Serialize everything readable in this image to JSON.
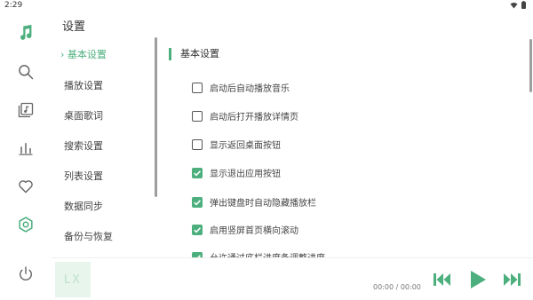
{
  "status_bar": {
    "time": "2:29"
  },
  "colors": {
    "accent": "#4caf7d",
    "accent_light": "#e8f5ec"
  },
  "rail": {
    "items": [
      {
        "name": "app-logo-icon"
      },
      {
        "name": "search-icon"
      },
      {
        "name": "music-library-icon"
      },
      {
        "name": "leaderboard-icon"
      },
      {
        "name": "favorite-heart-icon"
      },
      {
        "name": "settings-icon",
        "active": true
      },
      {
        "name": "power-icon"
      }
    ]
  },
  "page": {
    "title": "设置"
  },
  "settings_nav": {
    "items": [
      {
        "label": "基本设置",
        "active": true,
        "marker": "›"
      },
      {
        "label": "播放设置"
      },
      {
        "label": "桌面歌词"
      },
      {
        "label": "搜索设置"
      },
      {
        "label": "列表设置"
      },
      {
        "label": "数据同步"
      },
      {
        "label": "备份与恢复"
      }
    ]
  },
  "content": {
    "section_title": "基本设置",
    "options": [
      {
        "label": "启动后自动播放音乐",
        "checked": false
      },
      {
        "label": "启动后打开播放详情页",
        "checked": false
      },
      {
        "label": "显示返回桌面按钮",
        "checked": false
      },
      {
        "label": "显示退出应用按钮",
        "checked": true
      },
      {
        "label": "弹出键盘时自动隐藏播放栏",
        "checked": true
      },
      {
        "label": "启用竖屏首页横向滚动",
        "checked": true
      },
      {
        "label": "允许通过底栏进度条调整进度",
        "checked": true
      }
    ]
  },
  "player": {
    "cover_text": "LX",
    "time": "00:00 / 00:00",
    "controls": [
      "previous-icon",
      "play-icon",
      "next-icon"
    ]
  }
}
